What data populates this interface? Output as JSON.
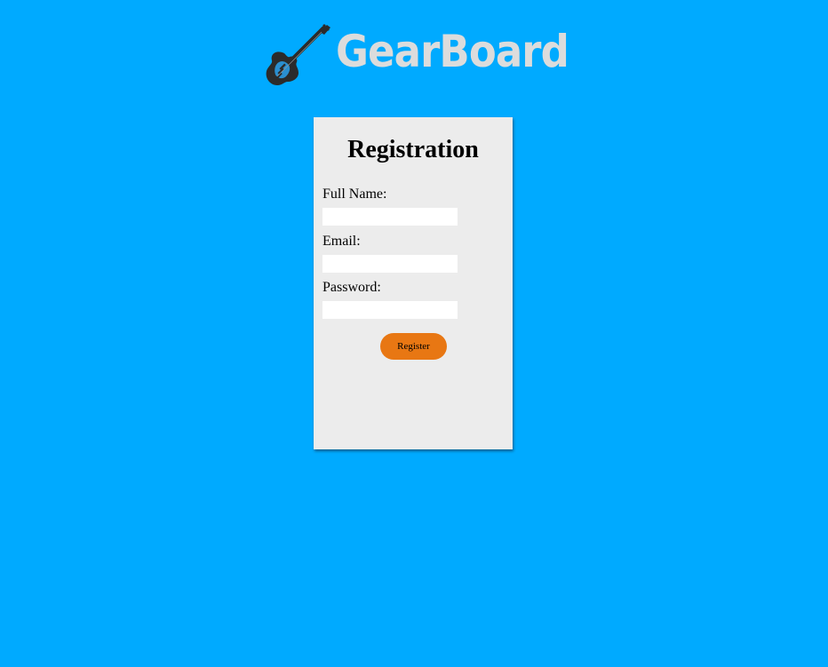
{
  "brand": {
    "name": "GearBoard",
    "icon": "electric-guitar-icon"
  },
  "form": {
    "title": "Registration",
    "fields": [
      {
        "label": "Full Name:",
        "value": "",
        "type": "text"
      },
      {
        "label": "Email:",
        "value": "",
        "type": "email"
      },
      {
        "label": "Password:",
        "value": "",
        "type": "password"
      }
    ],
    "submit_label": "Register"
  },
  "colors": {
    "background": "#00aaff",
    "card": "#ececec",
    "button": "#e87713",
    "logo_text": "#dcdcdc",
    "logo_icon": "#2b2b2b"
  }
}
